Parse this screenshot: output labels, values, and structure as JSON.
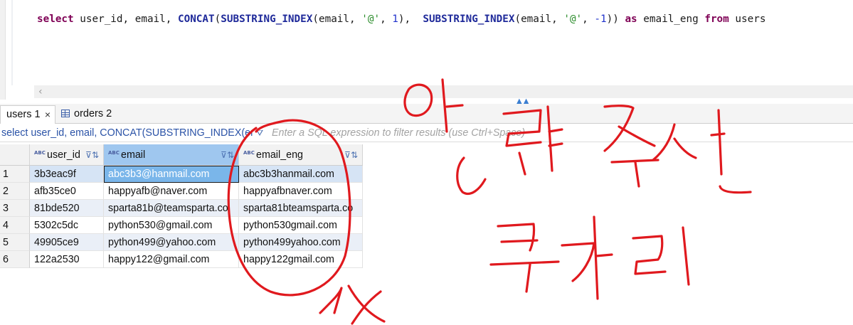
{
  "editor": {
    "sql_tokens": [
      {
        "t": "select",
        "c": "kw"
      },
      {
        "t": " user_id, email, ",
        "c": "ident"
      },
      {
        "t": "CONCAT",
        "c": "fn"
      },
      {
        "t": "(",
        "c": "ident"
      },
      {
        "t": "SUBSTRING_INDEX",
        "c": "fn"
      },
      {
        "t": "(email, ",
        "c": "ident"
      },
      {
        "t": "'@'",
        "c": "str"
      },
      {
        "t": ", ",
        "c": "ident"
      },
      {
        "t": "1",
        "c": "num"
      },
      {
        "t": "),  ",
        "c": "ident"
      },
      {
        "t": "SUBSTRING_INDEX",
        "c": "fn"
      },
      {
        "t": "(email, ",
        "c": "ident"
      },
      {
        "t": "'@'",
        "c": "str"
      },
      {
        "t": ", ",
        "c": "ident"
      },
      {
        "t": "-1",
        "c": "num"
      },
      {
        "t": ")) ",
        "c": "ident"
      },
      {
        "t": "as",
        "c": "kw"
      },
      {
        "t": " email_eng ",
        "c": "ident"
      },
      {
        "t": "from",
        "c": "kw"
      },
      {
        "t": " users",
        "c": "ident"
      }
    ]
  },
  "tabs": [
    {
      "label": "users 1",
      "close": "×"
    },
    {
      "label": "orders 2"
    }
  ],
  "filter": {
    "query_text": "select user_id, email, CONCAT(SUBSTRING_INDEX(email,",
    "placeholder": "Enter a SQL expression to filter results (use Ctrl+Space)"
  },
  "icons": {
    "type_badge": "ABC",
    "sort": "⊽⇅",
    "filter": "⛛",
    "scroll_left": "‹",
    "sash": "▲▲"
  },
  "columns": [
    {
      "name": "user_id",
      "type": "ABC"
    },
    {
      "name": "email",
      "type": "ABC"
    },
    {
      "name": "email_eng",
      "type": "ABC"
    }
  ],
  "rows": [
    {
      "n": "1",
      "user_id": "3b3eac9f",
      "email": "abc3b3@hanmail.com",
      "email_eng": "abc3b3hanmail.com"
    },
    {
      "n": "2",
      "user_id": "afb35ce0",
      "email": "happyafb@naver.com",
      "email_eng": "happyafbnaver.com"
    },
    {
      "n": "3",
      "user_id": "81bde520",
      "email": "sparta81b@teamsparta.co",
      "email_eng": "sparta81bteamsparta.co"
    },
    {
      "n": "4",
      "user_id": "5302c5dc",
      "email": "python530@gmail.com",
      "email_eng": "python530gmail.com"
    },
    {
      "n": "5",
      "user_id": "49905ce9",
      "email": "python499@yahoo.com",
      "email_eng": "python499yahoo.com"
    },
    {
      "n": "6",
      "user_id": "122a2530",
      "email": "happy122@gmail.com",
      "email_eng": "happy122gmail.com"
    }
  ],
  "colors": {
    "keyword": "#7f0055",
    "function": "#1f2a9a",
    "string": "#2a8c2a",
    "number": "#2233cc",
    "ink": "#e0191e",
    "selected_header": "#9fc7ef",
    "selected_cell": "#7ab6ea"
  }
}
